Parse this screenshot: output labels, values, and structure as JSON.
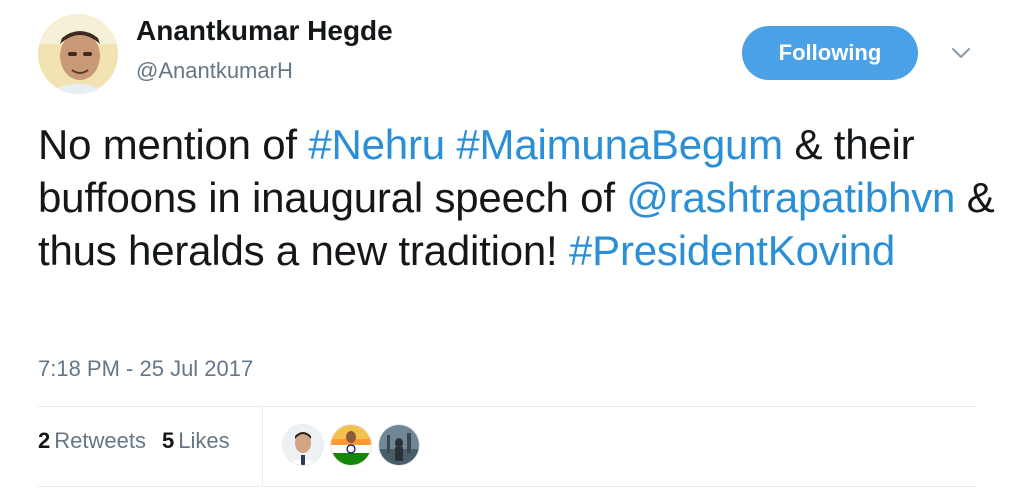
{
  "author": {
    "display_name": "Anantkumar Hegde",
    "screen_name": "@AnantkumarH"
  },
  "follow_button": {
    "label": "Following"
  },
  "caret_icon": "chevron-down-icon",
  "tweet": {
    "segments": [
      {
        "text": "No mention of ",
        "type": "text"
      },
      {
        "text": "#Nehru",
        "type": "hashtag"
      },
      {
        "text": " ",
        "type": "text"
      },
      {
        "text": "#MaimunaBegum",
        "type": "hashtag"
      },
      {
        "text": " & their buffoons in inaugural speech of ",
        "type": "text"
      },
      {
        "text": "@rashtrapatibhvn",
        "type": "mention"
      },
      {
        "text": " & thus heralds a new tradition! ",
        "type": "text"
      },
      {
        "text": "#PresidentKovind",
        "type": "hashtag"
      }
    ],
    "timestamp": "7:18 PM - 25 Jul 2017"
  },
  "stats": {
    "retweets_count": "2",
    "retweets_label": "Retweets",
    "likes_count": "5",
    "likes_label": "Likes"
  },
  "colors": {
    "link": "#2a8fd6",
    "follow_button_bg": "#4aa1e6",
    "secondary_text": "#657786",
    "primary_text": "#14171a"
  }
}
